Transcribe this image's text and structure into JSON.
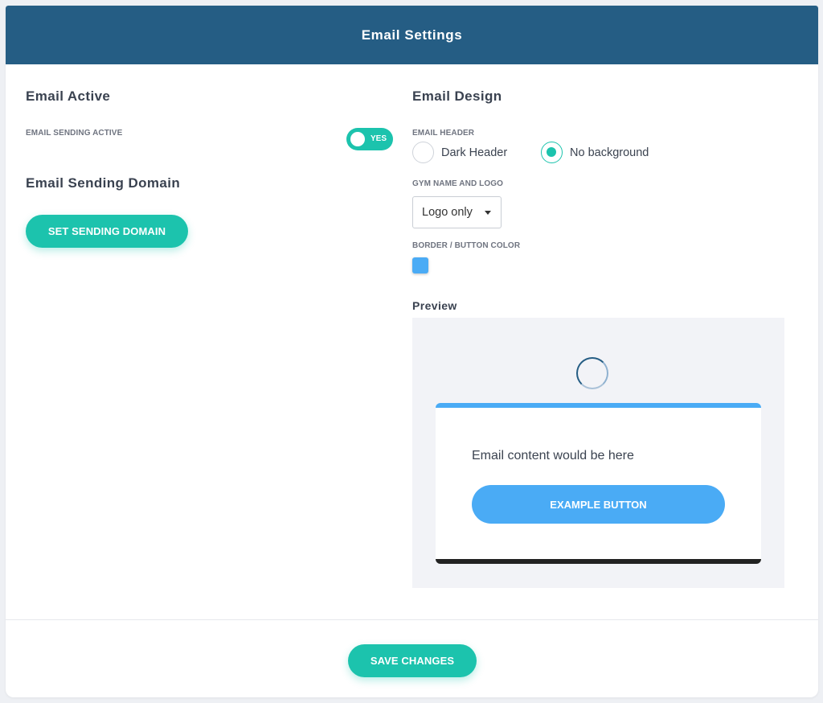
{
  "header": {
    "title": "Email Settings"
  },
  "email_active": {
    "title": "Email Active",
    "sending_label": "EMAIL SENDING ACTIVE",
    "toggle_text": "YES",
    "toggle_on": true
  },
  "domain": {
    "title": "Email Sending Domain",
    "button_label": "SET SENDING DOMAIN"
  },
  "design": {
    "title": "Email Design",
    "header_label": "EMAIL HEADER",
    "header_options": [
      {
        "label": "Dark Header",
        "selected": false
      },
      {
        "label": "No background",
        "selected": true
      }
    ],
    "logo_label": "GYM NAME AND LOGO",
    "logo_value": "Logo only",
    "color_label": "BORDER / BUTTON COLOR",
    "color_value": "#4aabf5"
  },
  "preview": {
    "title": "Preview",
    "content_text": "Email content would be here",
    "button_label": "EXAMPLE BUTTON"
  },
  "footer": {
    "save_label": "SAVE CHANGES"
  },
  "colors": {
    "header_bg": "#255d84",
    "accent": "#1cc3ad",
    "button_color": "#4aabf5"
  }
}
